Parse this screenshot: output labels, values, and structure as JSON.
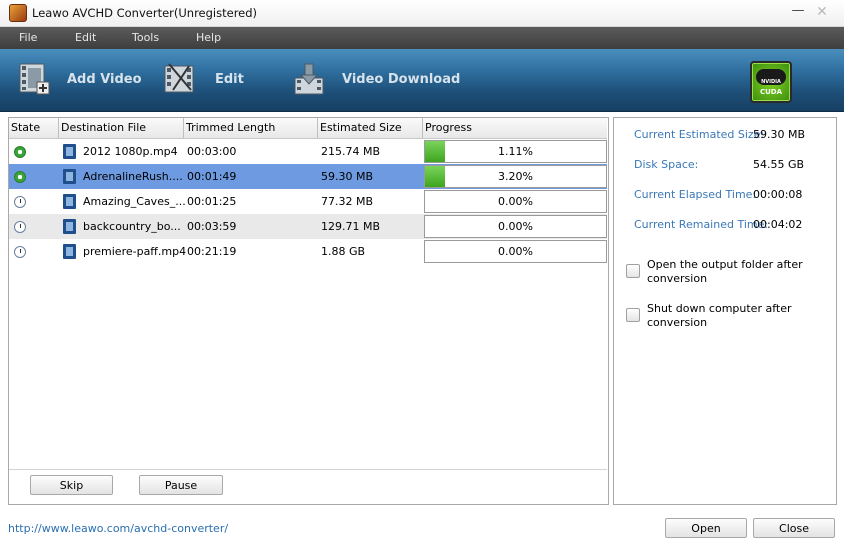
{
  "window": {
    "title": "Leawo AVCHD Converter(Unregistered)"
  },
  "menu": [
    "File",
    "Edit",
    "Tools",
    "Help"
  ],
  "toolbar": {
    "add_video": "Add Video",
    "edit": "Edit",
    "video_download": "Video Download",
    "badge_line1": "NVIDIA",
    "badge_line2": "CUDA"
  },
  "table": {
    "columns": [
      "State",
      "Destination File",
      "Trimmed Length",
      "Estimated Size",
      "Progress"
    ],
    "rows": [
      {
        "state": "converting",
        "file": "2012 1080p.mp4",
        "length": "00:03:00",
        "size": "215.74 MB",
        "progress_text": "1.11%",
        "progress": 0.0111,
        "selected": false
      },
      {
        "state": "converting",
        "file": "AdrenalineRush....",
        "length": "00:01:49",
        "size": "59.30 MB",
        "progress_text": "3.20%",
        "progress": 0.032,
        "selected": true
      },
      {
        "state": "waiting",
        "file": "Amazing_Caves_...",
        "length": "00:01:25",
        "size": "77.32 MB",
        "progress_text": "0.00%",
        "progress": 0,
        "selected": false
      },
      {
        "state": "waiting",
        "file": "backcountry_bo...",
        "length": "00:03:59",
        "size": "129.71 MB",
        "progress_text": "0.00%",
        "progress": 0,
        "selected": false
      },
      {
        "state": "waiting",
        "file": "premiere-paff.mp4",
        "length": "00:21:19",
        "size": "1.88 GB",
        "progress_text": "0.00%",
        "progress": 0,
        "selected": false
      }
    ]
  },
  "buttons": {
    "skip": "Skip",
    "pause": "Pause",
    "open": "Open",
    "close": "Close"
  },
  "info": {
    "current_estimated_size_label": "Current Estimated Size:",
    "current_estimated_size": "59.30 MB",
    "disk_space_label": "Disk Space:",
    "disk_space": "54.55 GB",
    "elapsed_label": "Current Elapsed Time:",
    "elapsed": "00:00:08",
    "remained_label": "Current Remained Time:",
    "remained": "00:04:02"
  },
  "options": {
    "open_folder": "Open the output folder after conversion",
    "shutdown": "Shut down computer after conversion"
  },
  "footer": {
    "link": "http://www.leawo.com/avchd-converter/"
  },
  "colors": {
    "selected_row": "#6d9ae0",
    "progress_fill": "#4fb82e",
    "info_label": "#3a78b8",
    "toolbar": "#2f6f9f"
  }
}
